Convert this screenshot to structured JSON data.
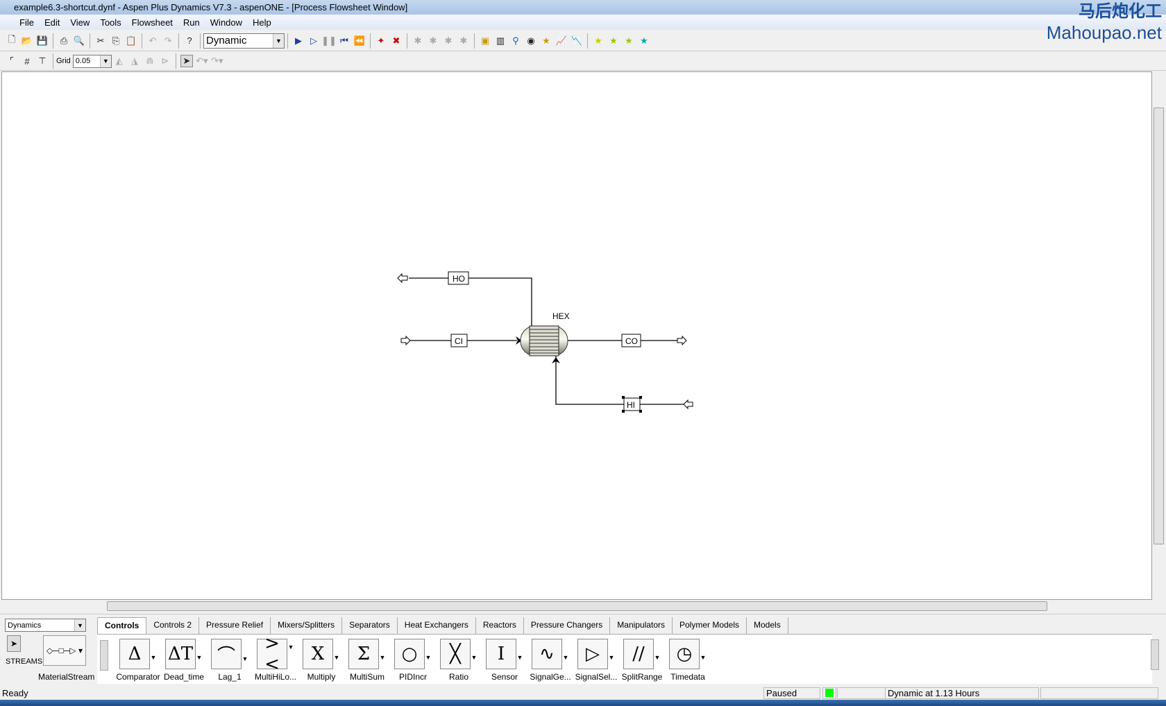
{
  "window": {
    "title": "example6.3-shortcut.dynf - Aspen Plus Dynamics V7.3 - aspenONE - [Process Flowsheet Window]"
  },
  "watermark": {
    "cn": "马后炮化工",
    "site": "Mahoupao.net"
  },
  "menu": [
    "File",
    "Edit",
    "View",
    "Tools",
    "Flowsheet",
    "Run",
    "Window",
    "Help"
  ],
  "toolbar": {
    "run_mode": "Dynamic",
    "grid_label": "Grid",
    "grid_value": "0.05"
  },
  "flowsheet": {
    "block": "HEX",
    "streams": [
      "HO",
      "CI",
      "CO",
      "HI"
    ]
  },
  "palette": {
    "library": "Dynamics",
    "streams_label": "STREAMS",
    "material_stream": "MaterialStream",
    "tabs": [
      "Controls",
      "Controls 2",
      "Pressure Relief",
      "Mixers/Splitters",
      "Separators",
      "Heat Exchangers",
      "Reactors",
      "Pressure Changers",
      "Manipulators",
      "Polymer Models",
      "Models"
    ],
    "active_tab": "Controls",
    "models": [
      {
        "label": "Comparator",
        "glyph": "Δ"
      },
      {
        "label": "Dead_time",
        "glyph": "ΔT"
      },
      {
        "label": "Lag_1",
        "glyph": "⌒"
      },
      {
        "label": "MultiHiLo...",
        "glyph": "><"
      },
      {
        "label": "Multiply",
        "glyph": "X"
      },
      {
        "label": "MultiSum",
        "glyph": "Σ"
      },
      {
        "label": "PIDIncr",
        "glyph": "○"
      },
      {
        "label": "Ratio",
        "glyph": "╳"
      },
      {
        "label": "Sensor",
        "glyph": "I"
      },
      {
        "label": "SignalGe...",
        "glyph": "∿"
      },
      {
        "label": "SignalSel...",
        "glyph": "▷"
      },
      {
        "label": "SplitRange",
        "glyph": "//"
      },
      {
        "label": "Timedata",
        "glyph": "◷"
      }
    ]
  },
  "status": {
    "left": "Ready",
    "run_state": "Paused",
    "indicator_color": "#00ff00",
    "time": "Dynamic at 1.13 Hours"
  }
}
